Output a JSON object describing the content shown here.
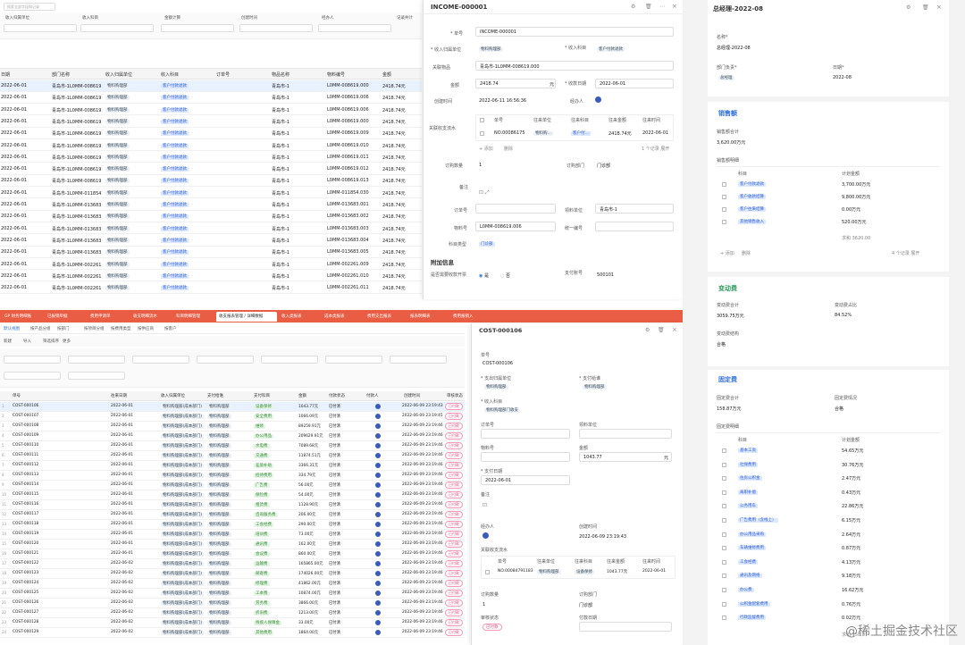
{
  "top_grid": {
    "search_placeholder": "搜索全部字段和记录",
    "filters": [
      "收入归属单位",
      "收入科目",
      "金额计算",
      "创建时间",
      "经办人",
      "记录共计"
    ],
    "columns": [
      "日期",
      "部门名称",
      "收入归属单位",
      "收入科目",
      "订单号",
      "物品名称",
      "物料编号",
      "金额"
    ],
    "rows": [
      [
        "2022-06-01",
        "青岛市-1L0MM-008619",
        "物料购理部",
        "客户付款退款",
        "",
        "青岛市-1",
        "L0MM-008619.000",
        "2418.74元"
      ],
      [
        "2022-06-01",
        "青岛市-1L0MM-008619",
        "物料购理部",
        "客户付款退款",
        "",
        "青岛市-1",
        "L0MM-008619.006",
        "2418.74元"
      ],
      [
        "2022-06-01",
        "青岛市-1L0MM-008619",
        "物料购理部",
        "客户付款退款",
        "",
        "青岛市-1",
        "L0MM-008619.006",
        "2418.74元"
      ],
      [
        "2022-06-01",
        "青岛市-1L0MM-008619",
        "物料购理部",
        "客户付款退款",
        "",
        "青岛市-1",
        "L0MM-008619.000",
        "2418.74元"
      ],
      [
        "2022-06-01",
        "青岛市-1L0MM-008619",
        "物料购理部",
        "客户付款退款",
        "",
        "青岛市-1",
        "L0MM-008619.009",
        "2418.74元"
      ],
      [
        "2022-06-01",
        "青岛市-1L0MM-008619",
        "物料购理部",
        "客户付款退款",
        "",
        "青岛市-1",
        "L0MM-008619.010",
        "2418.74元"
      ],
      [
        "2022-06-01",
        "青岛市-1L0MM-008619",
        "物料购理部",
        "客户付款退款",
        "",
        "青岛市-1",
        "L0MM-008619.011",
        "2418.74元"
      ],
      [
        "2022-06-01",
        "青岛市-1L0MM-008619",
        "物料购理部",
        "客户付款退款",
        "",
        "青岛市-1",
        "L0MM-008619.012",
        "2418.74元"
      ],
      [
        "2022-06-01",
        "青岛市-1L0MM-008619",
        "物料购理部",
        "客户付款退款",
        "",
        "青岛市-1",
        "L0MM-008619.013",
        "2418.74元"
      ],
      [
        "2022-06-01",
        "青岛市-1L0MM-011854",
        "物料购理部",
        "客户付款退款",
        "",
        "青岛市-1",
        "L0MM-011854.030",
        "2418.74元"
      ],
      [
        "2022-06-01",
        "青岛市-1L0MM-013683",
        "物料购理部",
        "客户付款退款",
        "",
        "青岛市-1",
        "L0MM-013683.001",
        "2418.74元"
      ],
      [
        "2022-06-01",
        "青岛市-1L0MM-013683",
        "物料购理部",
        "客户付款退款",
        "",
        "青岛市-1",
        "L0MM-013683.002",
        "2418.74元"
      ],
      [
        "2022-06-01",
        "青岛市-1L0MM-013683",
        "物料购理部",
        "客户付款退款",
        "",
        "青岛市-1",
        "L0MM-013683.003",
        "2418.74元"
      ],
      [
        "2022-06-01",
        "青岛市-1L0MM-013683",
        "物料购理部",
        "客户付款退款",
        "",
        "青岛市-1",
        "L0MM-013683.004",
        "2418.74元"
      ],
      [
        "2022-06-01",
        "青岛市-1L0MM-013683",
        "物料购理部",
        "客户付款退款",
        "",
        "青岛市-1",
        "L0MM-013683.005",
        "2418.74元"
      ],
      [
        "2022-06-01",
        "青岛市-1L0MM-002261",
        "物料购理部",
        "客户付款退款",
        "",
        "青岛市-1",
        "L0MM-002261.009",
        "2418.74元"
      ],
      [
        "2022-06-01",
        "青岛市-1L0MM-002261",
        "物料购理部",
        "客户付款退款",
        "",
        "青岛市-1",
        "L0MM-002261.010",
        "2418.74元"
      ],
      [
        "2022-06-01",
        "青岛市-1L0MM-002261",
        "物料购理部",
        "客户付款退款",
        "",
        "青岛市-1",
        "L0MM-002261.011",
        "2418.74元"
      ]
    ]
  },
  "income_detail": {
    "title": "INCOME-000001",
    "fields": {
      "num_label": "* 单号",
      "num_value": "INCOME-000001",
      "unit_label": "* 收入归属单位",
      "unit_value": "物料购理部",
      "subject_label": "* 收入科目",
      "subject_value": "客户付款退款",
      "goods_label": "关联物品",
      "goods_value": "青岛市-1L0MM-008619.000",
      "amount_label": "金额",
      "amount_value": "2418.74",
      "amount_unit": "元",
      "date_label": "* 收款日期",
      "date_value": "2022-06-01",
      "created_label": "创建时间",
      "created_value": "2022-06-11 16:56:36",
      "creator_label": "经办人",
      "related_label": "关联收支流水",
      "related_cols": [
        "单号",
        "往来单位",
        "往来科目",
        "往来金额",
        "往来时间"
      ],
      "related_row": [
        "NO.00086175",
        "物料购...",
        "客户付...",
        "2418.74元",
        "2022-06-01"
      ],
      "add_label": "+ 添加",
      "delete_label": "删除",
      "expand_label": "1 个记录 展开",
      "qty_label": "订购数量",
      "qty_value": "1",
      "dept_label": "订购部门",
      "dept_value": "门诊部",
      "note_label": "备注",
      "order_label": "订单号",
      "recv_label": "领料单位",
      "recv_value": "青岛市-1",
      "mat_label": "物料号",
      "mat_value": "L0MM-008619.006",
      "uni_label": "统一编号",
      "type_label": "科目类型",
      "type_value": "门诊部",
      "extra_title": "附加信息",
      "inout_label": "是否需要收款开票",
      "opt_yes": "是",
      "opt_no": "否",
      "bank_label": "支付账号",
      "bank_value": "500101"
    }
  },
  "summary": {
    "title": "总经理-2022-08",
    "name_label": "名称*",
    "name_value": "总经理-2022-08",
    "role_label": "部门负责*",
    "role_value": "总经理",
    "month_label": "日期*",
    "month_value": "2022-08",
    "sales_title": "销售额",
    "sales_total_label": "销售额合计",
    "sales_total_value": "3,620.00万元",
    "sales_table_label": "销售额明细",
    "sales_cols": [
      "科目",
      "计划金额"
    ],
    "sales_rows": [
      [
        "客户付款退款",
        "3,700.00万元"
      ],
      [
        "客户收款结算",
        "9,800.00万元"
      ],
      [
        "客户往来结算",
        "0.00万元"
      ],
      [
        "其他销售收入",
        "520.00万元"
      ]
    ],
    "sales_sum": "求和 3620.00",
    "sales_add": "+ 添加",
    "sales_del": "删除",
    "sales_expand": "4 个记录 展开",
    "var_title": "变动费",
    "var_total_label": "变动费合计",
    "var_total_value": "3059.75万元",
    "var_pct_label": "变动费占比",
    "var_pct_value": "84.52%",
    "var_status_label": "变动费结构",
    "var_status_value": "合格",
    "fix_title": "固定费",
    "fix_total_label": "固定费合计",
    "fix_total_value": "158.87万元",
    "fix_status_label": "固定费情况",
    "fix_status_value": "合格",
    "fix_table_label": "固定费明细",
    "fix_cols": [
      "科目",
      "计划金额"
    ],
    "fix_rows": [
      [
        "基本工资",
        "54.65万元"
      ],
      [
        "社保费用",
        "30.76万元"
      ],
      [
        "住房公积金",
        "2.47万元"
      ],
      [
        "离职补偿",
        "0.43万元"
      ],
      [
        "公务用车",
        "22.86万元"
      ],
      [
        "广告费用（含线上）",
        "6.15万元"
      ],
      [
        "办公用品采购",
        "2.64万元"
      ],
      [
        "车辆维修费用",
        "0.87万元"
      ],
      [
        "工会经费",
        "4.13万元"
      ],
      [
        "通讯及网络",
        "9.18万元"
      ],
      [
        "办公费",
        "16.62万元"
      ],
      [
        "公积金配套费用",
        "0.76万元"
      ],
      [
        "行政监督费用",
        "0.02万元"
      ]
    ],
    "fix_sum": "求和 158.87"
  },
  "cost_grid": {
    "tabs": [
      "GP 财务明细账",
      "已报销单据",
      "费用申请单",
      "收支明细流水",
      "科目明细管理",
      "收支报表管理 / 详细数据",
      "收入类报表",
      "成本类报表",
      "费用支出报表",
      "报表明细表",
      "费用报销入"
    ],
    "active_tab": 5,
    "view_tabs": [
      "默认视图",
      "按产品分组",
      "按部门",
      "按项目分组",
      "按费用类型",
      "按供应商",
      "按客户"
    ],
    "toolbar": [
      "新建",
      "导入",
      "筛选排序",
      "更多"
    ],
    "columns": [
      "单号",
      "往来日期",
      "收入归属单位",
      "支付给谁",
      "支付科目",
      "金额",
      "付款状态",
      "付款人",
      "创建时间",
      "审核状态"
    ],
    "rows": [
      [
        "COST-000106",
        "2022-06-01",
        "物料购理部(成本部门)",
        "物料购理部",
        "设备保修",
        "1043.77元",
        "已付清",
        "2022-06-09 23:19:43",
        "已付款"
      ],
      [
        "COST-000107",
        "2022-06-01",
        "物料购理部(成本部门)",
        "物料购理部",
        "安全费用",
        "1066.09元",
        "已付清",
        "2022-06-09 23:19:45",
        "已付款"
      ],
      [
        "COST-000108",
        "2022-06-01",
        "物料购理部(成本部门)",
        "物料购理部",
        "维修",
        "89259.91元",
        "已付清",
        "2022-06-09 23:19:46",
        "已付款"
      ],
      [
        "COST-000109",
        "2022-06-01",
        "物料购理部(成本部门)",
        "物料购理部",
        "办公用品",
        "209629.91元",
        "已付清",
        "2022-06-09 23:19:46",
        "已付款"
      ],
      [
        "COST-000110",
        "2022-06-01",
        "物料购理部(成本部门)",
        "物料购理部",
        "水电费",
        "7089.68元",
        "已付清",
        "2022-06-09 23:19:46",
        "已付款"
      ],
      [
        "COST-000111",
        "2022-06-01",
        "物料购理部(成本部门)",
        "物料购理部",
        "交通费",
        "11874.51元",
        "已付清",
        "2022-06-09 23:19:46",
        "已付款"
      ],
      [
        "COST-000112",
        "2022-06-01",
        "物料购理部(成本部门)",
        "物料购理部",
        "差旅补助",
        "3366.31元",
        "已付清",
        "2022-06-09 23:19:46",
        "已付款"
      ],
      [
        "COST-000113",
        "2022-06-01",
        "物料购理部(成本部门)",
        "物料购理部",
        "招待费用",
        "334.79元",
        "已付清",
        "2022-06-09 23:19:46",
        "已付款"
      ],
      [
        "COST-000114",
        "2022-06-01",
        "物料购理部(成本部门)",
        "物料购理部",
        "广告费",
        "56.00元",
        "已付清",
        "2022-06-09 23:19:46",
        "已付款"
      ],
      [
        "COST-000115",
        "2022-06-01",
        "物料购理部(成本部门)",
        "物料购理部",
        "保险费",
        "54.00元",
        "已付清",
        "2022-06-09 23:19:46",
        "已付款"
      ],
      [
        "COST-000116",
        "2022-06-01",
        "物料购理部(成本部门)",
        "物料购理部",
        "租赁费",
        "1128.90元",
        "已付清",
        "2022-06-09 23:19:46",
        "已付款"
      ],
      [
        "COST-000117",
        "2022-06-01",
        "物料购理部(成本部门)",
        "物料购理部",
        "咨询服务费",
        "206.00元",
        "已付清",
        "2022-06-09 23:19:46",
        "已付款"
      ],
      [
        "COST-000118",
        "2022-06-01",
        "物料购理部(成本部门)",
        "物料购理部",
        "工会经费",
        "290.00元",
        "已付清",
        "2022-06-09 23:19:46",
        "已付款"
      ],
      [
        "COST-000119",
        "2022-06-01",
        "物料购理部(成本部门)",
        "物料购理部",
        "培训费",
        "73.00元",
        "已付清",
        "2022-06-09 23:19:46",
        "已付款"
      ],
      [
        "COST-000120",
        "2022-06-01",
        "物料购理部(成本部门)",
        "物料购理部",
        "通讯费",
        "162.00元",
        "已付清",
        "2022-06-09 23:19:46",
        "已付款"
      ],
      [
        "COST-000121",
        "2022-06-01",
        "物料购理部(成本部门)",
        "物料购理部",
        "会议费",
        "860.00元",
        "已付清",
        "2022-06-09 23:19:46",
        "已付款"
      ],
      [
        "COST-000122",
        "2022-06-02",
        "物料购理部(成本部门)",
        "物料购理部",
        "运输费",
        "165865.00元",
        "已付清",
        "2022-06-09 23:19:46",
        "已付款"
      ],
      [
        "COST-000123",
        "2022-06-02",
        "物料购理部(成本部门)",
        "物料购理部",
        "邮寄费",
        "174026.00元",
        "已付清",
        "2022-06-09 23:19:46",
        "已付款"
      ],
      [
        "COST-000124",
        "2022-06-02",
        "物料购理部(成本部门)",
        "物料购理部",
        "修理费",
        "41862.00元",
        "已付清",
        "2022-06-09 23:19:46",
        "已付款"
      ],
      [
        "COST-000125",
        "2022-06-02",
        "物料购理部(成本部门)",
        "物料购理部",
        "工本费",
        "10874.00元",
        "已付清",
        "2022-06-09 23:19:46",
        "已付款"
      ],
      [
        "COST-000126",
        "2022-06-02",
        "物料购理部(成本部门)",
        "物料购理部",
        "劳务费",
        "3866.00元",
        "已付清",
        "2022-06-09 23:19:46",
        "已付款"
      ],
      [
        "COST-000127",
        "2022-06-02",
        "物料购理部(成本部门)",
        "物料购理部",
        "折旧费",
        "1213.00元",
        "已付清",
        "2022-06-09 23:19:46",
        "已付款"
      ],
      [
        "COST-000128",
        "2022-06-02",
        "物料购理部(成本部门)",
        "物料购理部",
        "残疾人保障金",
        "33.00元",
        "已付清",
        "2022-06-09 23:19:46",
        "已付款"
      ],
      [
        "COST-000129",
        "2022-06-02",
        "物料购理部(成本部门)",
        "物料购理部",
        "其他费用",
        "1864.00元",
        "已付清",
        "2022-06-09 23:19:46",
        "已付款"
      ]
    ]
  },
  "cost_detail": {
    "title": "COST-000106",
    "num_label": "单号",
    "num_value": "COST-000106",
    "unit_label": "* 支出归属单位",
    "unit_value": "物料购理部",
    "pay_label": "* 支付给谁",
    "pay_value": "物料购理部",
    "subject_label": "* 收入科目",
    "subject_value": "物料购理部门收支",
    "order_label": "订单号",
    "recv_label": "领料单位",
    "mat_label": "物料号",
    "amount_label": "金额",
    "amount_value": "1043.77",
    "amount_unit": "元",
    "date_label": "* 支付日期",
    "date_value": "2022-06-01",
    "note_label": "备注",
    "creator_label": "经办人",
    "created_label": "创建时间",
    "created_value": "2022-06-09 23:19:43",
    "rel_label": "关联收支流水",
    "rel_cols": [
      "单号",
      "往来单位",
      "往来科目",
      "往来金额",
      "往来时间"
    ],
    "rel_row": [
      "NO.00084791183",
      "物料购理部",
      "设备保修",
      "1043.77元",
      "2022-06-01"
    ],
    "qty_label": "订购数量",
    "qty_value": "1",
    "dept_label": "订购部门",
    "dept_value": "门诊部",
    "status_label": "审核状态",
    "status_value": "已付款",
    "pay_date_label": "付款日期"
  },
  "watermark": "@稀土掘金技术社区"
}
